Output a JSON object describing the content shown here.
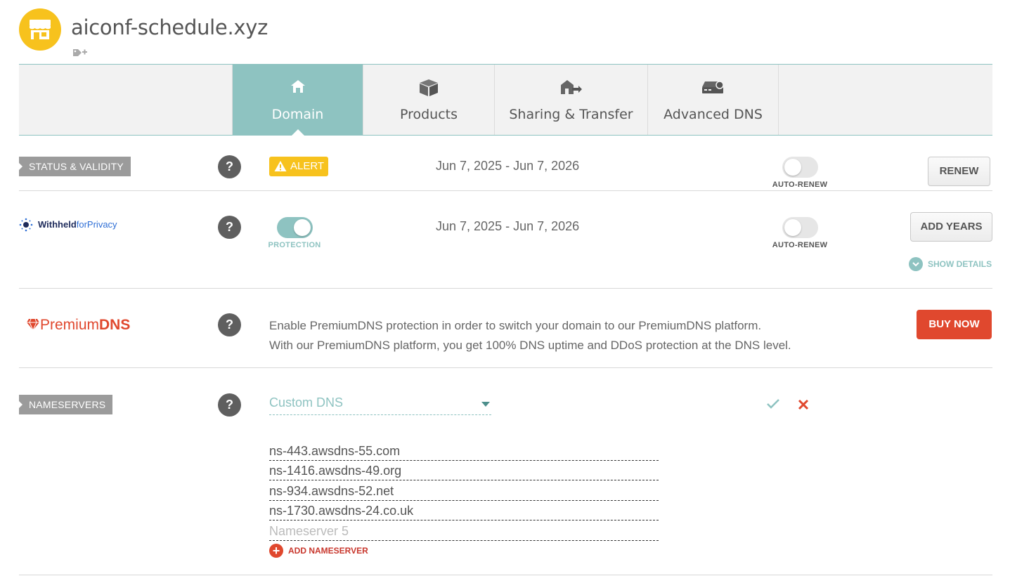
{
  "header": {
    "domain_name": "aiconf-schedule.xyz",
    "logo_icon": "storefront-icon",
    "tag_icon": "add-tag-icon",
    "brand_color": "#f7c21d"
  },
  "tabs": [
    {
      "label": "Domain",
      "icon": "home-icon",
      "active": true
    },
    {
      "label": "Products",
      "icon": "box-icon",
      "active": false
    },
    {
      "label": "Sharing & Transfer",
      "icon": "house-transfer-icon",
      "active": false
    },
    {
      "label": "Advanced DNS",
      "icon": "server-icon",
      "active": false
    }
  ],
  "status": {
    "label": "STATUS & VALIDITY",
    "alert": "ALERT",
    "dates": "Jun 7, 2025 - Jun 7, 2026",
    "auto_renew_label": "AUTO-RENEW",
    "auto_renew_on": false,
    "renew_button": "RENEW"
  },
  "privacy": {
    "logo_text_bold": "Withheld",
    "logo_text_rest": "forPrivacy",
    "protection_label": "PROTECTION",
    "protection_on": true,
    "dates": "Jun 7, 2025 - Jun 7, 2026",
    "auto_renew_label": "AUTO-RENEW",
    "auto_renew_on": false,
    "add_years_button": "ADD YEARS",
    "show_details": "SHOW DETAILS"
  },
  "premium_dns": {
    "logo_text": "Premium",
    "logo_text_bold": "DNS",
    "description_line1": "Enable PremiumDNS protection in order to switch your domain to our PremiumDNS platform.",
    "description_line2": "With our PremiumDNS platform, you get 100% DNS uptime and DDoS protection at the DNS level.",
    "buy_button": "BUY NOW"
  },
  "nameservers": {
    "label": "NAMESERVERS",
    "selected": "Custom DNS",
    "entries": [
      "ns-443.awsdns-55.com",
      "ns-1416.awsdns-49.org",
      "ns-934.awsdns-52.net",
      "ns-1730.awsdns-24.co.uk"
    ],
    "placeholder_5": "Nameserver 5",
    "add_label": "ADD NAMESERVER"
  },
  "colors": {
    "accent_teal": "#8ec3c1",
    "danger_red": "#e0482e",
    "alert_yellow": "#f7c21d"
  }
}
